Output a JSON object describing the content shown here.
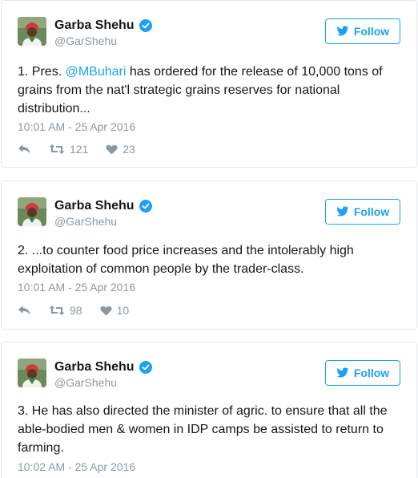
{
  "tweets": [
    {
      "author": {
        "name": "Garba Shehu",
        "handle": "@GarShehu",
        "verified": true
      },
      "follow_label": "Follow",
      "text_parts": [
        "1. Pres. ",
        "@MBuhari",
        " has ordered for the release of 10,000 tons of grains from the nat'l strategic grains reserves for national distribution..."
      ],
      "timestamp": "10:01 AM - 25 Apr 2016",
      "retweets": "121",
      "likes": "23"
    },
    {
      "author": {
        "name": "Garba Shehu",
        "handle": "@GarShehu",
        "verified": true
      },
      "follow_label": "Follow",
      "text": "2. ...to counter food price increases and the intolerably high exploitation of common people by the trader-class.",
      "timestamp": "10:01 AM - 25 Apr 2016",
      "retweets": "98",
      "likes": "10"
    },
    {
      "author": {
        "name": "Garba Shehu",
        "handle": "@GarShehu",
        "verified": true
      },
      "follow_label": "Follow",
      "text": "3. He has also directed the minister of agric. to ensure that all the able-bodied men & women in IDP camps be assisted to return to farming.",
      "timestamp": "10:02 AM - 25 Apr 2016"
    }
  ],
  "icons": {
    "verified": "verified-badge-icon",
    "bird": "twitter-bird-icon",
    "reply": "reply-icon",
    "retweet": "retweet-icon",
    "like": "heart-icon"
  },
  "colors": {
    "accent": "#1da1f2",
    "muted": "#8899a6",
    "border": "#e1e8ed"
  }
}
